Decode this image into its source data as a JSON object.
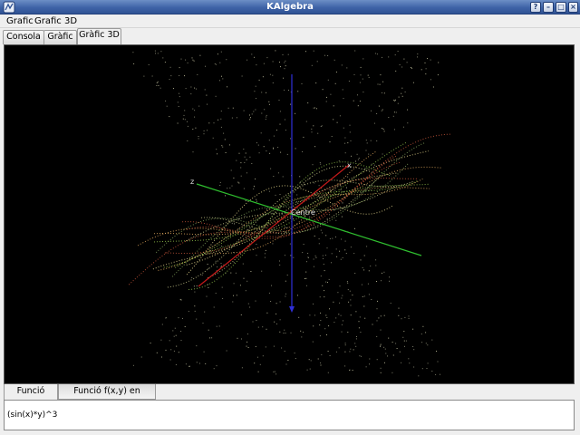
{
  "window": {
    "title": "KAlgebra",
    "buttons": {
      "help": "?",
      "minimize": "–",
      "maximize": "□",
      "close": "×"
    }
  },
  "menubar": {
    "items": [
      "Grafic",
      "Grafic 3D"
    ]
  },
  "tabs": [
    "Consola",
    "Gràfic",
    "Gràfic 3D"
  ],
  "active_tab": "Gràfic 3D",
  "plot3d": {
    "axis_labels": {
      "x": "x",
      "z": "z"
    },
    "center_label": "Centre",
    "axis_colors": {
      "x": "#c41a1a",
      "y": "#2f2fd8",
      "z": "#2fbf2f"
    },
    "point_colors": [
      "#c7c78a",
      "#d9a35a",
      "#8fbf4a",
      "#c4553a",
      "#7fa05a",
      "#e0d28a"
    ]
  },
  "bottom_tabs": [
    "Funció f(x,y)",
    "Funció f(x,y) en MathML"
  ],
  "active_bottom_tab": "Funció f(x,y)",
  "editor": {
    "expression": "(sin(x)*y)^3"
  }
}
